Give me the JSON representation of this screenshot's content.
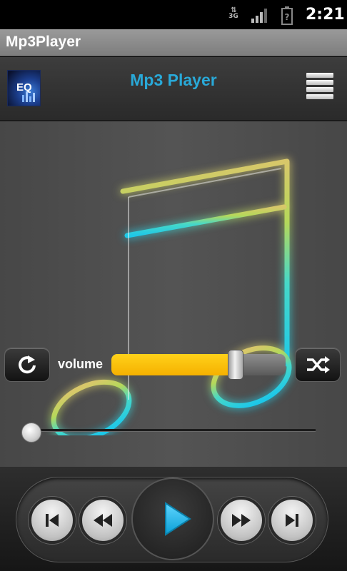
{
  "status_bar": {
    "network": "3G",
    "time": "2:21",
    "icons": [
      "data-arrows-icon",
      "signal-icon",
      "battery-icon"
    ]
  },
  "titlebar": {
    "title": "Mp3Player"
  },
  "header": {
    "eq_label": "EQ",
    "title": "Mp3 Player",
    "title_color": "#29a9d8"
  },
  "controls": {
    "volume_label": "volume",
    "volume_level": 0.71,
    "seek_progress": 0.0,
    "accent_color": "#f5b000",
    "play_icon_color": "#1fb6e8"
  }
}
